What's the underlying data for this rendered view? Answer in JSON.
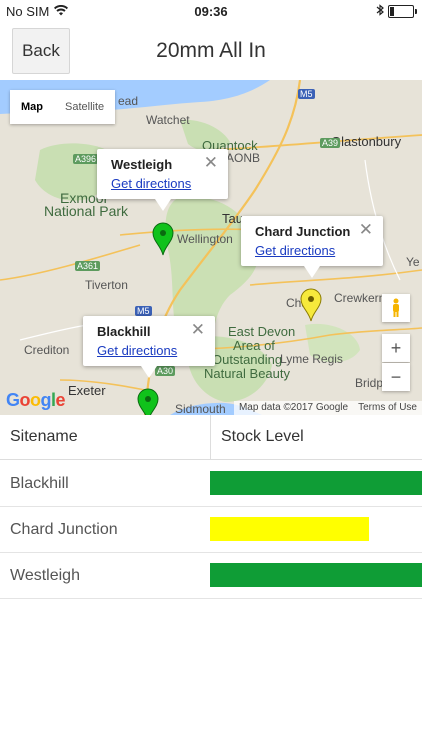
{
  "status": {
    "carrier": "No SIM",
    "time": "09:36"
  },
  "header": {
    "back_label": "Back",
    "title": "20mm All In"
  },
  "map": {
    "type_map": "Map",
    "type_satellite": "Satellite",
    "labels": {
      "watchet": "Watchet",
      "glastonbury": "Glastonbury",
      "exmoor": "Exmoor",
      "national_park": "National Park",
      "wellington": "Wellington",
      "tiverton": "Tiverton",
      "crewkerne": "Crewkerne",
      "crediton": "Crediton",
      "exeter": "Exeter",
      "lyme_regis": "Lyme Regis",
      "sidmouth": "Sidmouth",
      "bridport": "Bridp",
      "east_devon": "East Devon",
      "area_of": "Area of",
      "outstanding": "Outstanding",
      "natural_beauty": "Natural Beauty",
      "quantock": "Quantock",
      "aonb": "AONB",
      "taunton": "Tau",
      "chard": "Cha",
      "yeovil": "Ye",
      "m5_top": "M5",
      "m5_mid": "M5",
      "a39": "A39",
      "a396": "A396",
      "a361": "A361",
      "a30": "A30",
      "lead": "ead"
    },
    "infowindows": [
      {
        "name": "Westleigh",
        "link": "Get directions"
      },
      {
        "name": "Chard Junction",
        "link": "Get directions"
      },
      {
        "name": "Blackhill",
        "link": "Get directions"
      }
    ],
    "close_glyph": "✕",
    "zoom_in": "+",
    "zoom_out": "−",
    "google": [
      "G",
      "o",
      "o",
      "g",
      "l",
      "e"
    ],
    "attribution": "Map data ©2017 Google",
    "terms": "Terms of Use",
    "pin_colors": {
      "green": "#10c21b",
      "yellow": "#f6e93c"
    }
  },
  "table": {
    "headers": {
      "site": "Sitename",
      "level": "Stock Level"
    },
    "rows": [
      {
        "site": "Blackhill",
        "level": 1.0,
        "color": "#0f9d36"
      },
      {
        "site": "Chard Junction",
        "level": 0.75,
        "color": "#ffff00"
      },
      {
        "site": "Westleigh",
        "level": 1.0,
        "color": "#0f9d36"
      }
    ]
  }
}
